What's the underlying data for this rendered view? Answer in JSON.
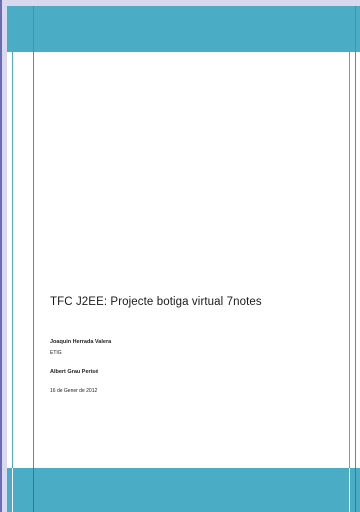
{
  "document": {
    "title": "TFC J2EE: Projecte  botiga virtual 7notes",
    "author": "Joaquin Herrada Valera",
    "program": "ETIG",
    "advisor": "Albert Grau Perisé",
    "date": "16 de Gener de 2012"
  },
  "colors": {
    "accent_band": "#4bacc6",
    "background": "#d8d8ee",
    "page": "#ffffff"
  }
}
